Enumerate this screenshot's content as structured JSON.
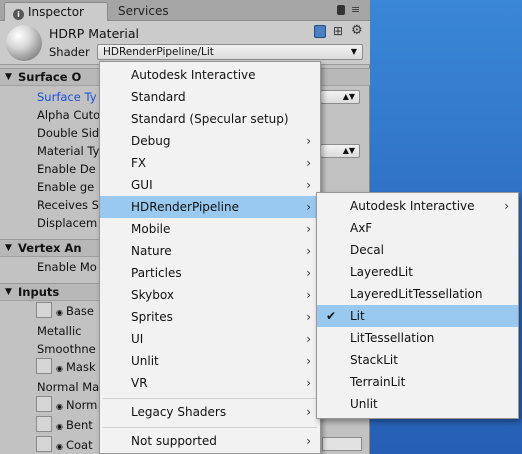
{
  "tabs": {
    "inspector": "Inspector",
    "services": "Services"
  },
  "header": {
    "material_name": "HDRP Material",
    "shader_label": "Shader",
    "shader_value": "HDRenderPipeline/Lit"
  },
  "sections": {
    "surface_options": {
      "title": "Surface O",
      "props": [
        "Surface Ty",
        "Alpha Cuto",
        "Double Sid",
        "Material Ty",
        "Enable De",
        "Enable ge",
        "Receives S",
        "Displacem"
      ]
    },
    "vertex_animation": {
      "title": "Vertex An",
      "props": [
        "Enable Mo"
      ]
    },
    "inputs": {
      "title": "Inputs",
      "props": [
        "Base",
        "Metallic",
        "Smoothne",
        "Mask",
        "Normal Ma",
        "Norm",
        "Bent",
        "Coat"
      ]
    }
  },
  "menu": {
    "items": [
      {
        "label": "Autodesk Interactive",
        "submenu": false
      },
      {
        "label": "Standard",
        "submenu": false
      },
      {
        "label": "Standard (Specular setup)",
        "submenu": false
      },
      {
        "label": "Debug",
        "submenu": true
      },
      {
        "label": "FX",
        "submenu": true
      },
      {
        "label": "GUI",
        "submenu": true
      },
      {
        "label": "HDRenderPipeline",
        "submenu": true
      },
      {
        "label": "Mobile",
        "submenu": true
      },
      {
        "label": "Nature",
        "submenu": true
      },
      {
        "label": "Particles",
        "submenu": true
      },
      {
        "label": "Skybox",
        "submenu": true
      },
      {
        "label": "Sprites",
        "submenu": true
      },
      {
        "label": "UI",
        "submenu": true
      },
      {
        "label": "Unlit",
        "submenu": true
      },
      {
        "label": "VR",
        "submenu": true
      },
      {
        "label": "Legacy Shaders",
        "submenu": true
      },
      {
        "label": "Not supported",
        "submenu": true
      }
    ],
    "highlighted": "HDRenderPipeline"
  },
  "submenu": {
    "items": [
      {
        "label": "Autodesk Interactive",
        "submenu": true
      },
      {
        "label": "AxF",
        "submenu": false
      },
      {
        "label": "Decal",
        "submenu": false
      },
      {
        "label": "LayeredLit",
        "submenu": false
      },
      {
        "label": "LayeredLitTessellation",
        "submenu": false
      },
      {
        "label": "Lit",
        "submenu": false
      },
      {
        "label": "LitTessellation",
        "submenu": false
      },
      {
        "label": "StackLit",
        "submenu": false
      },
      {
        "label": "TerrainLit",
        "submenu": false
      },
      {
        "label": "Unlit",
        "submenu": false
      }
    ],
    "selected": "Lit"
  },
  "icons": {
    "submenu_arrow": "chevron-right-icon",
    "check": "check-icon",
    "foldout": "triangle-down-icon"
  },
  "colors": {
    "highlight": "#99c9ef",
    "link_blue": "#1a4fd6",
    "panel": "#c2c2c2"
  }
}
